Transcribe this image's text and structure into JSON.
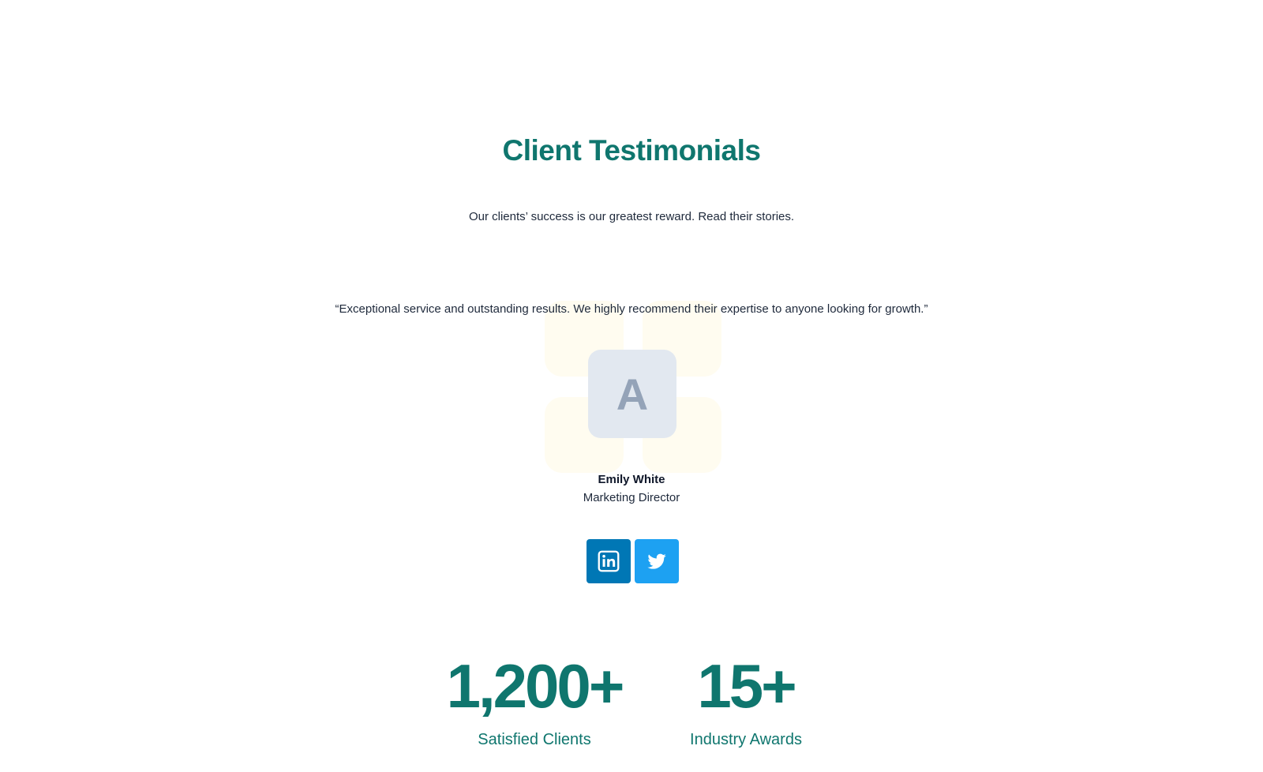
{
  "colors": {
    "accent": "#0f766e",
    "avatar_bg": "#e2e8f0",
    "linkedin": "#0077b5",
    "twitter": "#1da1f2"
  },
  "section": {
    "title": "Client Testimonials",
    "subtitle": "Our clients’ success is our greatest reward. Read their stories."
  },
  "testimonial": {
    "quote": "“Exceptional service and outstanding results. We highly recommend their expertise to anyone looking for growth.”",
    "avatar_letter": "A",
    "name": "Emily White",
    "role": "Marketing Director"
  },
  "socials": [
    {
      "icon": "linkedin-icon"
    },
    {
      "icon": "twitter-icon"
    }
  ],
  "stats": [
    {
      "value": "1,200+",
      "label": "Satisfied Clients"
    },
    {
      "value": "15+",
      "label": "Industry Awards"
    }
  ]
}
